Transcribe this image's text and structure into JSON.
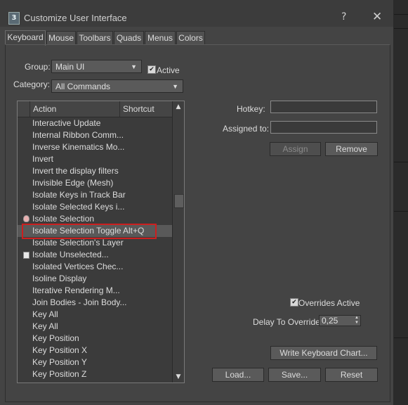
{
  "window": {
    "title": "Customize User Interface",
    "icon_label": "3",
    "help": "?",
    "close": "✕"
  },
  "tabs": [
    {
      "label": "Keyboard",
      "active": true
    },
    {
      "label": "Mouse"
    },
    {
      "label": "Toolbars"
    },
    {
      "label": "Quads"
    },
    {
      "label": "Menus"
    },
    {
      "label": "Colors"
    }
  ],
  "group": {
    "label": "Group:",
    "value": "Main UI"
  },
  "active_checkbox": {
    "label": "Active",
    "checked": true
  },
  "category": {
    "label": "Category:",
    "value": "All Commands"
  },
  "list": {
    "headers": {
      "action": "Action",
      "shortcut": "Shortcut"
    },
    "rows": [
      {
        "action": "Interactive Update",
        "shortcut": ""
      },
      {
        "action": "Internal Ribbon Comm...",
        "shortcut": ""
      },
      {
        "action": "Inverse Kinematics Mo...",
        "shortcut": ""
      },
      {
        "action": "Invert",
        "shortcut": ""
      },
      {
        "action": "Invert the display filters",
        "shortcut": ""
      },
      {
        "action": "Invisible Edge (Mesh)",
        "shortcut": ""
      },
      {
        "action": "Isolate Keys in Track Bar",
        "shortcut": ""
      },
      {
        "action": "Isolate Selected Keys i...",
        "shortcut": ""
      },
      {
        "action": "Isolate Selection",
        "shortcut": "",
        "icon": "lightbulb-icon"
      },
      {
        "action": "Isolate Selection Toggle",
        "shortcut": "Alt+Q",
        "selected": true
      },
      {
        "action": "Isolate Selection's Layer",
        "shortcut": ""
      },
      {
        "action": "Isolate Unselected...",
        "shortcut": "",
        "icon": "box-icon"
      },
      {
        "action": "Isolated Vertices Chec...",
        "shortcut": ""
      },
      {
        "action": "Isoline Display",
        "shortcut": ""
      },
      {
        "action": "Iterative Rendering M...",
        "shortcut": ""
      },
      {
        "action": "Join Bodies - Join Body...",
        "shortcut": ""
      },
      {
        "action": "Key All",
        "shortcut": ""
      },
      {
        "action": "Key All",
        "shortcut": ""
      },
      {
        "action": "Key Position",
        "shortcut": ""
      },
      {
        "action": "Key Position X",
        "shortcut": ""
      },
      {
        "action": "Key Position Y",
        "shortcut": ""
      },
      {
        "action": "Key Position Z",
        "shortcut": ""
      }
    ]
  },
  "hotkey": {
    "label": "Hotkey:",
    "value": ""
  },
  "assigned_to": {
    "label": "Assigned to:",
    "value": ""
  },
  "buttons": {
    "assign": "Assign",
    "remove": "Remove",
    "write_chart": "Write Keyboard Chart...",
    "load": "Load...",
    "save": "Save...",
    "reset": "Reset"
  },
  "overrides_active": {
    "label": "Overrides Active",
    "checked": true
  },
  "delay_override": {
    "label": "Delay To Override:",
    "value": "0,25"
  }
}
